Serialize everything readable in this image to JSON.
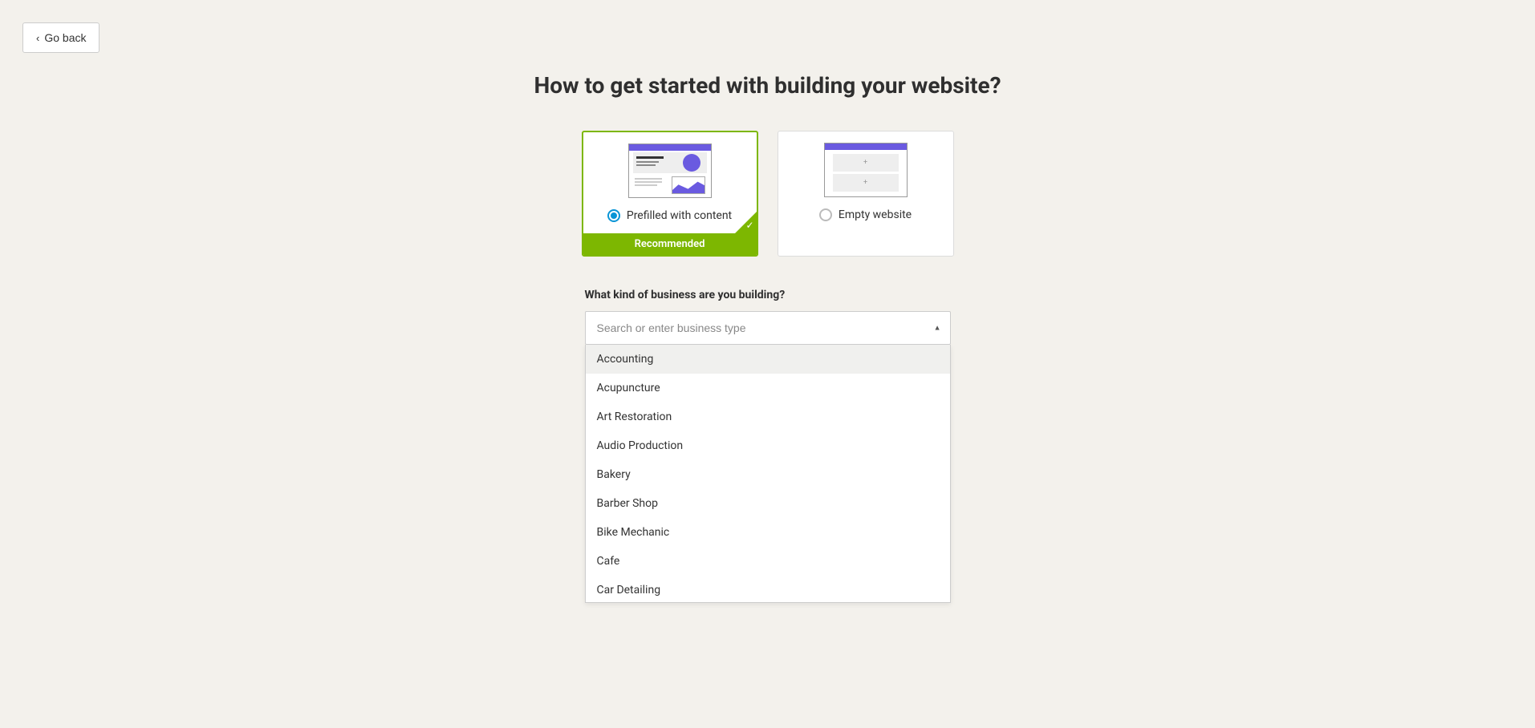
{
  "back_button": {
    "label": "Go back"
  },
  "headline": "How to get started with building your website?",
  "options": {
    "prefilled": {
      "label": "Prefilled with content",
      "recommended_label": "Recommended",
      "selected": true
    },
    "empty": {
      "label": "Empty website",
      "selected": false
    }
  },
  "business_type": {
    "label": "What kind of business are you building?",
    "placeholder": "Search or enter business type",
    "options": [
      "Accounting",
      "Acupuncture",
      "Art Restoration",
      "Audio Production",
      "Bakery",
      "Barber Shop",
      "Bike Mechanic",
      "Cafe",
      "Car Detailing"
    ]
  }
}
